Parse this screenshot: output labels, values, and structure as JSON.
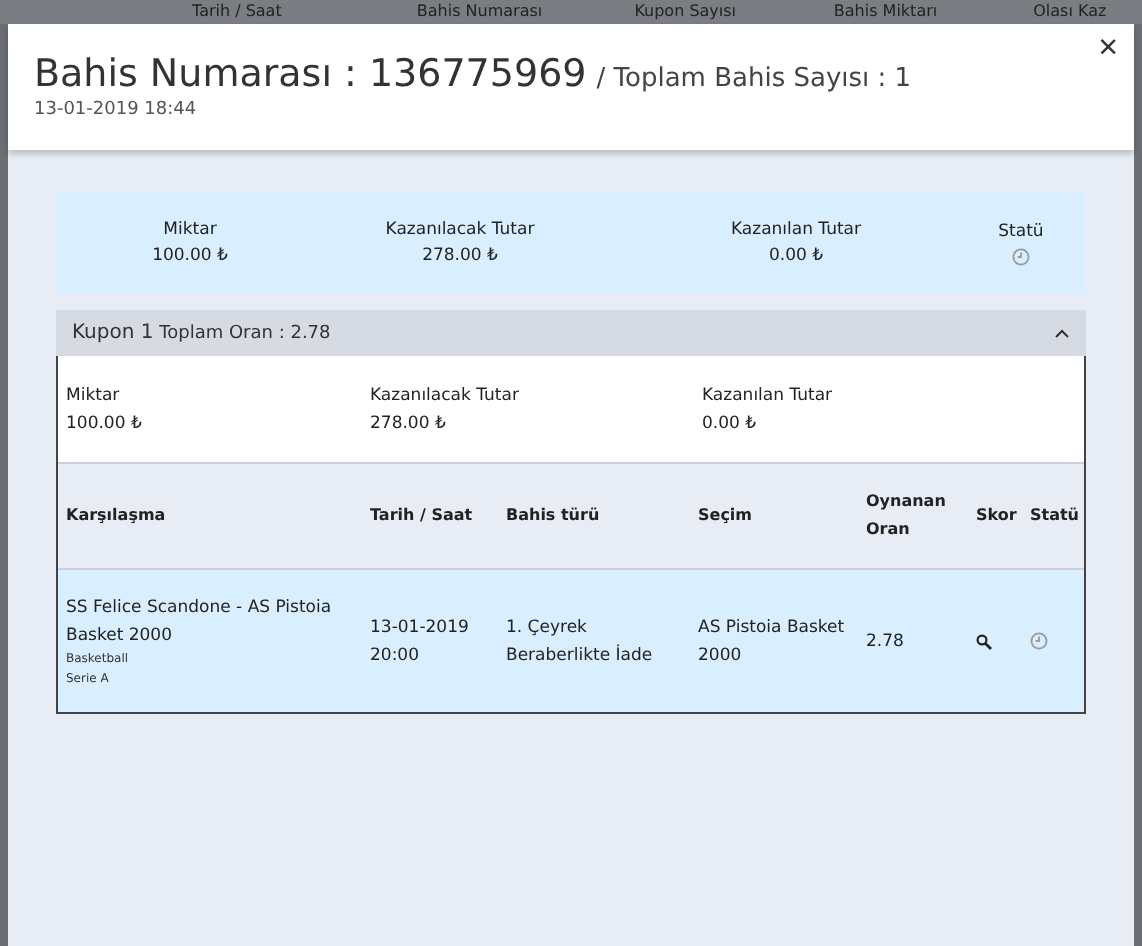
{
  "background_table": {
    "columns": [
      "Tarih / Saat",
      "Bahis Numarası",
      "Kupon Sayısı",
      "Bahis Miktarı",
      "Olası Kaz"
    ]
  },
  "modal": {
    "title": "Bahis Numarası : 136775969",
    "subtitle": "/ Toplam Bahis Sayısı : 1",
    "date": "13-01-2019 18:44",
    "close": "×",
    "summary": [
      {
        "label": "Miktar",
        "value": "100.00 ₺",
        "kind": "text"
      },
      {
        "label": "Kazanılacak Tutar",
        "value": "278.00 ₺",
        "kind": "text"
      },
      {
        "label": "Kazanılan Tutar",
        "value": "0.00 ₺",
        "kind": "text"
      },
      {
        "label": "Statü",
        "kind": "icon"
      }
    ],
    "coupon": {
      "title": "Kupon 1",
      "total": "Toplam Oran : 2.78",
      "expanded": true,
      "amounts": [
        {
          "label": "Miktar",
          "value": "100.00 ₺"
        },
        {
          "label": "Kazanılacak Tutar",
          "value": "278.00 ₺"
        },
        {
          "label": "Kazanılan Tutar",
          "value": "0.00 ₺"
        }
      ],
      "columns": [
        "Karşılaşma",
        "Tarih / Saat",
        "Bahis türü",
        "Seçim",
        "Oynanan Oran",
        "Skor",
        "Statü"
      ],
      "rows": [
        {
          "match": "SS Felice Scandone - AS Pistoia Basket 2000",
          "sport": "Basketball",
          "league": "Serie A",
          "datetime": "13-01-2019 20:00",
          "bet_type": "1. Çeyrek Beraberlikte İade",
          "selection": "AS Pistoia Basket 2000",
          "odds": "2.78"
        }
      ]
    }
  }
}
